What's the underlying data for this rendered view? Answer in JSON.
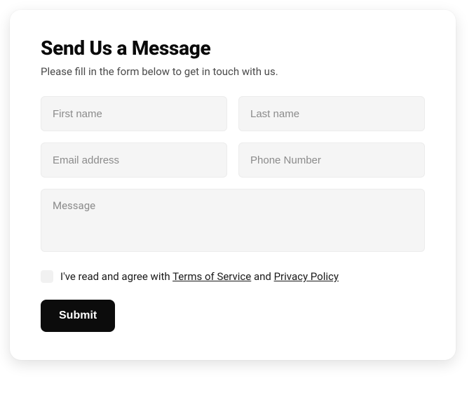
{
  "header": {
    "title": "Send Us a Message",
    "subtitle": "Please fill in the form below to get in touch with us."
  },
  "form": {
    "first_name": {
      "value": "",
      "placeholder": "First name"
    },
    "last_name": {
      "value": "",
      "placeholder": "Last name"
    },
    "email": {
      "value": "",
      "placeholder": "Email address"
    },
    "phone": {
      "value": "",
      "placeholder": "Phone Number"
    },
    "message": {
      "value": "",
      "placeholder": "Message"
    }
  },
  "consent": {
    "checked": false,
    "prefix": "I've read and agree with ",
    "tos_label": "Terms of Service",
    "middle": " and ",
    "privacy_label": "Privacy Policy"
  },
  "actions": {
    "submit_label": "Submit"
  }
}
